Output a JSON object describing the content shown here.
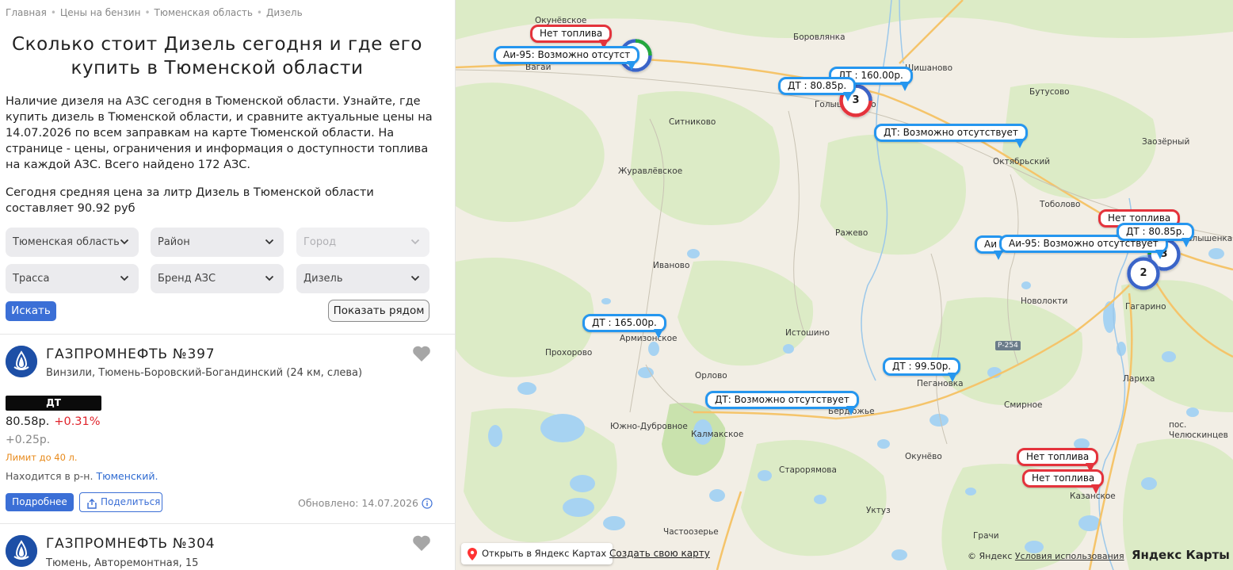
{
  "breadcrumbs": [
    "Главная",
    "Цены на бензин",
    "Тюменская область",
    "Дизель"
  ],
  "title": "Сколько стоит Дизель сегодня и где его купить в Тюменской области",
  "intro": "Наличие дизеля на АЗС сегодня в Тюменской области. Узнайте, где купить дизель в Тюменской области, и сравните актуальные цены на 14.07.2026 по всем заправкам на карте Тюменской области. На странице - цены, ограничения и информация о доступности топлива на каждой АЗС. Всего найдено 172 АЗС.",
  "avg_price_text": "Сегодня средняя цена за литр Дизель в Тюменской области составляет 90.92 руб",
  "filters": {
    "region": "Тюменская область",
    "district": "Район",
    "city": "Город",
    "highway": "Трасса",
    "brand": "Бренд АЗС",
    "fuel": "Дизель"
  },
  "buttons": {
    "search": "Искать",
    "nearby": "Показать рядом",
    "details": "Подробнее",
    "share": "Поделиться"
  },
  "stations": [
    {
      "name": "ГАЗПРОМНЕФТЬ №397",
      "address": "Винзили, Тюмень-Боровский-Богандинский (24 км, слева)",
      "fuel_badge": "ДТ",
      "price": "80.58р.",
      "change": "+0.31%",
      "delta": "+0.25р.",
      "limit": "Лимит до 40 л.",
      "location_prefix": "Находится в р-н.",
      "location_link": "Тюменский.",
      "updated": "Обновлено: 14.07.2026"
    },
    {
      "name": "ГАЗПРОМНЕФТЬ №304",
      "address": "Тюмень, Авторемонтная, 15"
    }
  ],
  "map": {
    "places": [
      "Окунёвское",
      "Боровлянка",
      "Вагай",
      "Шишаново",
      "Голышманово",
      "Бутусово",
      "Ситниково",
      "Октябрьский",
      "Заозёрный",
      "Журавлёвское",
      "Тоболово",
      "Ражево",
      "Малышенка",
      "Иваново",
      "Новолокти",
      "Гагарино",
      "Армизонское",
      "Истошино",
      "Прохорово",
      "Орлово",
      "Пегановка",
      "Лариха",
      "Бердюжье",
      "Смирное",
      "Южно-Дубровное",
      "Калмакское",
      "Окунёво",
      "пос. Челюскинцев",
      "Старорямова",
      "Казанское",
      "Уктуз",
      "Частоозерье",
      "Грачи"
    ],
    "road_label": "Р-254",
    "markers": [
      {
        "text": "Нет топлива",
        "color": "red"
      },
      {
        "text": "Аи-95: Возможно отсутст",
        "color": "blue"
      },
      {
        "text": "ДТ : 160.00р.",
        "color": "blue"
      },
      {
        "text": "ДТ : 80.85р.",
        "color": "blue"
      },
      {
        "text": "ДТ: Возможно отсутствует",
        "color": "blue"
      },
      {
        "text": "Нет топлива",
        "color": "red"
      },
      {
        "text": "ДТ : 80.85р.",
        "color": "blue"
      },
      {
        "text": "Аи",
        "color": "blue"
      },
      {
        "text": "Аи-95: Возможно отсутствует",
        "color": "blue"
      },
      {
        "text": "ДТ : 165.00р.",
        "color": "blue"
      },
      {
        "text": "ДТ : 99.50р.",
        "color": "blue"
      },
      {
        "text": "ДТ: Возможно отсутствует",
        "color": "blue"
      },
      {
        "text": "Нет топлива",
        "color": "red"
      },
      {
        "text": "Нет топлива",
        "color": "red"
      }
    ],
    "clusters": [
      "2",
      "3",
      "3",
      "2"
    ],
    "open_in_yandex": "Открыть в Яндекс Картах",
    "create_map": "Создать свою карту",
    "copyright": "© Яндекс",
    "terms": "Условия использования",
    "logo": "Яндекс Карты"
  },
  "colors": {
    "accent": "#3b6fd6",
    "price_up": "#e0242c",
    "limit": "#e88a1b",
    "pin_blue": "#2596ef",
    "pin_red": "#e4333c"
  }
}
